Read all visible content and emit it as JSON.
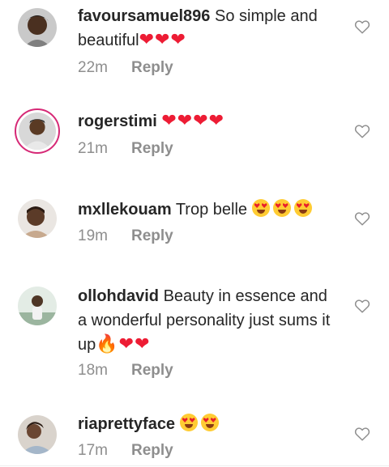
{
  "comments": [
    {
      "username": "favoursamuel896",
      "text": "So simple and beautiful",
      "emoji": "❤❤❤",
      "time": "22m",
      "reply_label": "Reply",
      "avatar_icon": "user-avatar",
      "has_story_ring": false
    },
    {
      "username": "rogerstimi",
      "text": "",
      "emoji": "❤❤❤❤",
      "time": "21m",
      "reply_label": "Reply",
      "avatar_icon": "user-avatar",
      "has_story_ring": true
    },
    {
      "username": "mxllekouam",
      "text": "Trop belle",
      "emoji": "heart-eyes x3",
      "time": "19m",
      "reply_label": "Reply",
      "avatar_icon": "user-avatar",
      "has_story_ring": false
    },
    {
      "username": "ollohdavid",
      "text": "Beauty in essence and a wonderful personality just sums it up",
      "emoji": "🔥❤❤",
      "time": "18m",
      "reply_label": "Reply",
      "avatar_icon": "user-avatar",
      "has_story_ring": false
    },
    {
      "username": "riaprettyface",
      "text": "",
      "emoji": "heart-eyes x2",
      "time": "17m",
      "reply_label": "Reply",
      "avatar_icon": "user-avatar",
      "has_story_ring": false
    }
  ],
  "icons": {
    "like": "heart-outline-icon"
  },
  "colors": {
    "text": "#262626",
    "meta": "#8e8e8e",
    "heart_emoji": "#ed1c34",
    "story_ring": "#d62976"
  }
}
